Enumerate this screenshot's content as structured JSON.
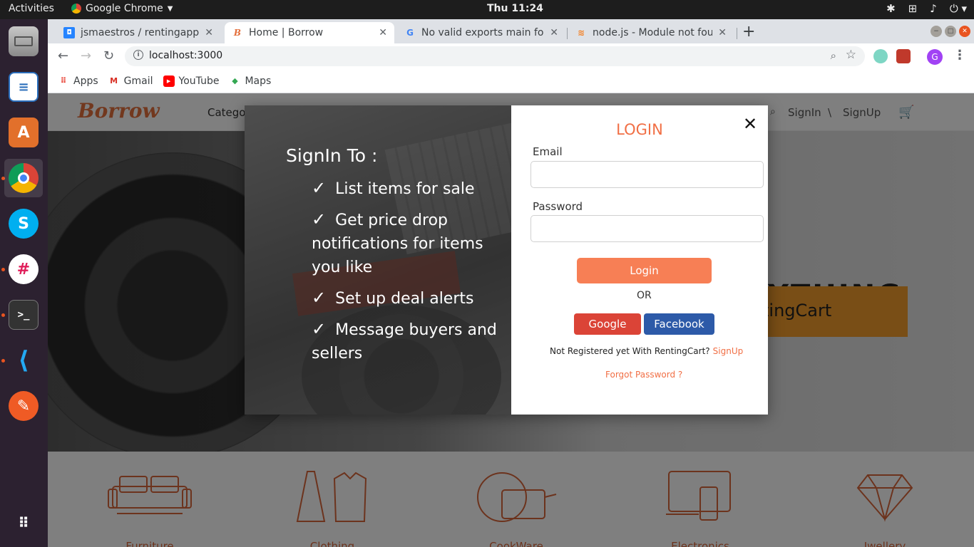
{
  "os": {
    "activities": "Activities",
    "app_menu": "Google Chrome",
    "clock": "Thu 11:24"
  },
  "browser": {
    "tabs": [
      {
        "title": "jsmaestros / rentingapp-f",
        "active": false
      },
      {
        "title": "Home | Borrow",
        "active": true
      },
      {
        "title": "No valid exports main fou",
        "active": false
      },
      {
        "title": "node.js - Module not foun",
        "active": false
      }
    ],
    "url": "localhost:3000",
    "profile_initial": "G",
    "bookmarks": [
      {
        "label": "Apps",
        "icon": "apps-grid-icon"
      },
      {
        "label": "Gmail",
        "icon": "gmail-icon"
      },
      {
        "label": "YouTube",
        "icon": "youtube-icon"
      },
      {
        "label": "Maps",
        "icon": "maps-icon"
      }
    ]
  },
  "site": {
    "logo": "Borrow",
    "nav_category": "Catego",
    "signin": "SignIn",
    "slash": "\\",
    "signup": "SignUp",
    "hero_text": "YTHING",
    "hero_button": "tingCart",
    "categories": [
      "Furniture",
      "Clothing",
      "CookWare",
      "Electronics",
      "Jwellery"
    ]
  },
  "modal": {
    "signin_title": "SignIn To :",
    "features": [
      "List items for sale",
      "Get price drop notifications for items you like",
      "Set up deal alerts",
      "Message buyers and sellers"
    ],
    "check_mark": "✓",
    "login_title": "LOGIN",
    "email_label": "Email",
    "password_label": "Password",
    "login_button": "Login",
    "or_text": "OR",
    "google_button": "Google",
    "facebook_button": "Facebook",
    "not_registered": "Not Registered yet With RentingCart?",
    "signup_link": "SignUp",
    "forgot_password": "Forgot Password ?"
  },
  "colors": {
    "accent": "#f16f45",
    "login_button": "#f77f55",
    "google": "#db4437",
    "facebook": "#2d5aa8"
  }
}
